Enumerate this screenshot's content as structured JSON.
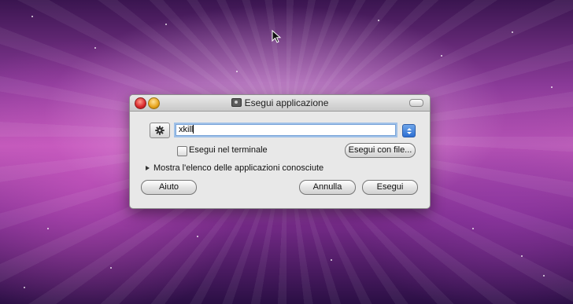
{
  "window": {
    "title": "Esegui applicazione"
  },
  "command": {
    "value": "xkill"
  },
  "options": {
    "run_in_terminal_label": "Esegui nel terminale",
    "run_in_terminal_checked": false,
    "run_with_file_label": "Esegui con file..."
  },
  "apps_list": {
    "toggle_label": "Mostra l'elenco delle applicazioni conosciute",
    "expanded": false
  },
  "buttons": {
    "help": "Aiuto",
    "cancel": "Annulla",
    "run": "Esegui"
  },
  "colors": {
    "focus_ring": "#7aa4d8",
    "combo_arrow": "#2d6fd2",
    "close_button": "#d8262a",
    "minimize_button": "#e7a31a"
  }
}
